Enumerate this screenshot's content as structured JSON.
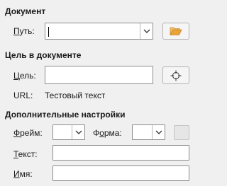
{
  "document_section": {
    "title": "Документ",
    "path_label_underlined": "П",
    "path_label_rest": "уть:",
    "path_value": "",
    "open_file_icon": "folder-open-icon",
    "dropdown_icon": "chevron-down-icon"
  },
  "target_section": {
    "title": "Цель в документе",
    "target_label_underlined": "Ц",
    "target_label_rest": "ель:",
    "target_value": "",
    "target_icon": "crosshair-icon",
    "url_label": "URL:",
    "url_value": "Тестовый текст"
  },
  "additional_section": {
    "title": "Дополнительные настройки",
    "frame_label_underlined": "Ф",
    "frame_label_rest": "рейм:",
    "frame_value": "",
    "form_label_before": "Ф",
    "form_label_underlined": "о",
    "form_label_rest": "рма:",
    "form_value": "",
    "text_label_underlined": "Т",
    "text_label_rest": "екст:",
    "text_value": "",
    "name_label_underlined": "И",
    "name_label_rest": "мя:",
    "name_value": "",
    "events_icon": "macro-events-icon"
  },
  "colors": {
    "background": "#f0f0f0",
    "field_border": "#8c8c8c",
    "folder_icon": "#e8a33b"
  }
}
